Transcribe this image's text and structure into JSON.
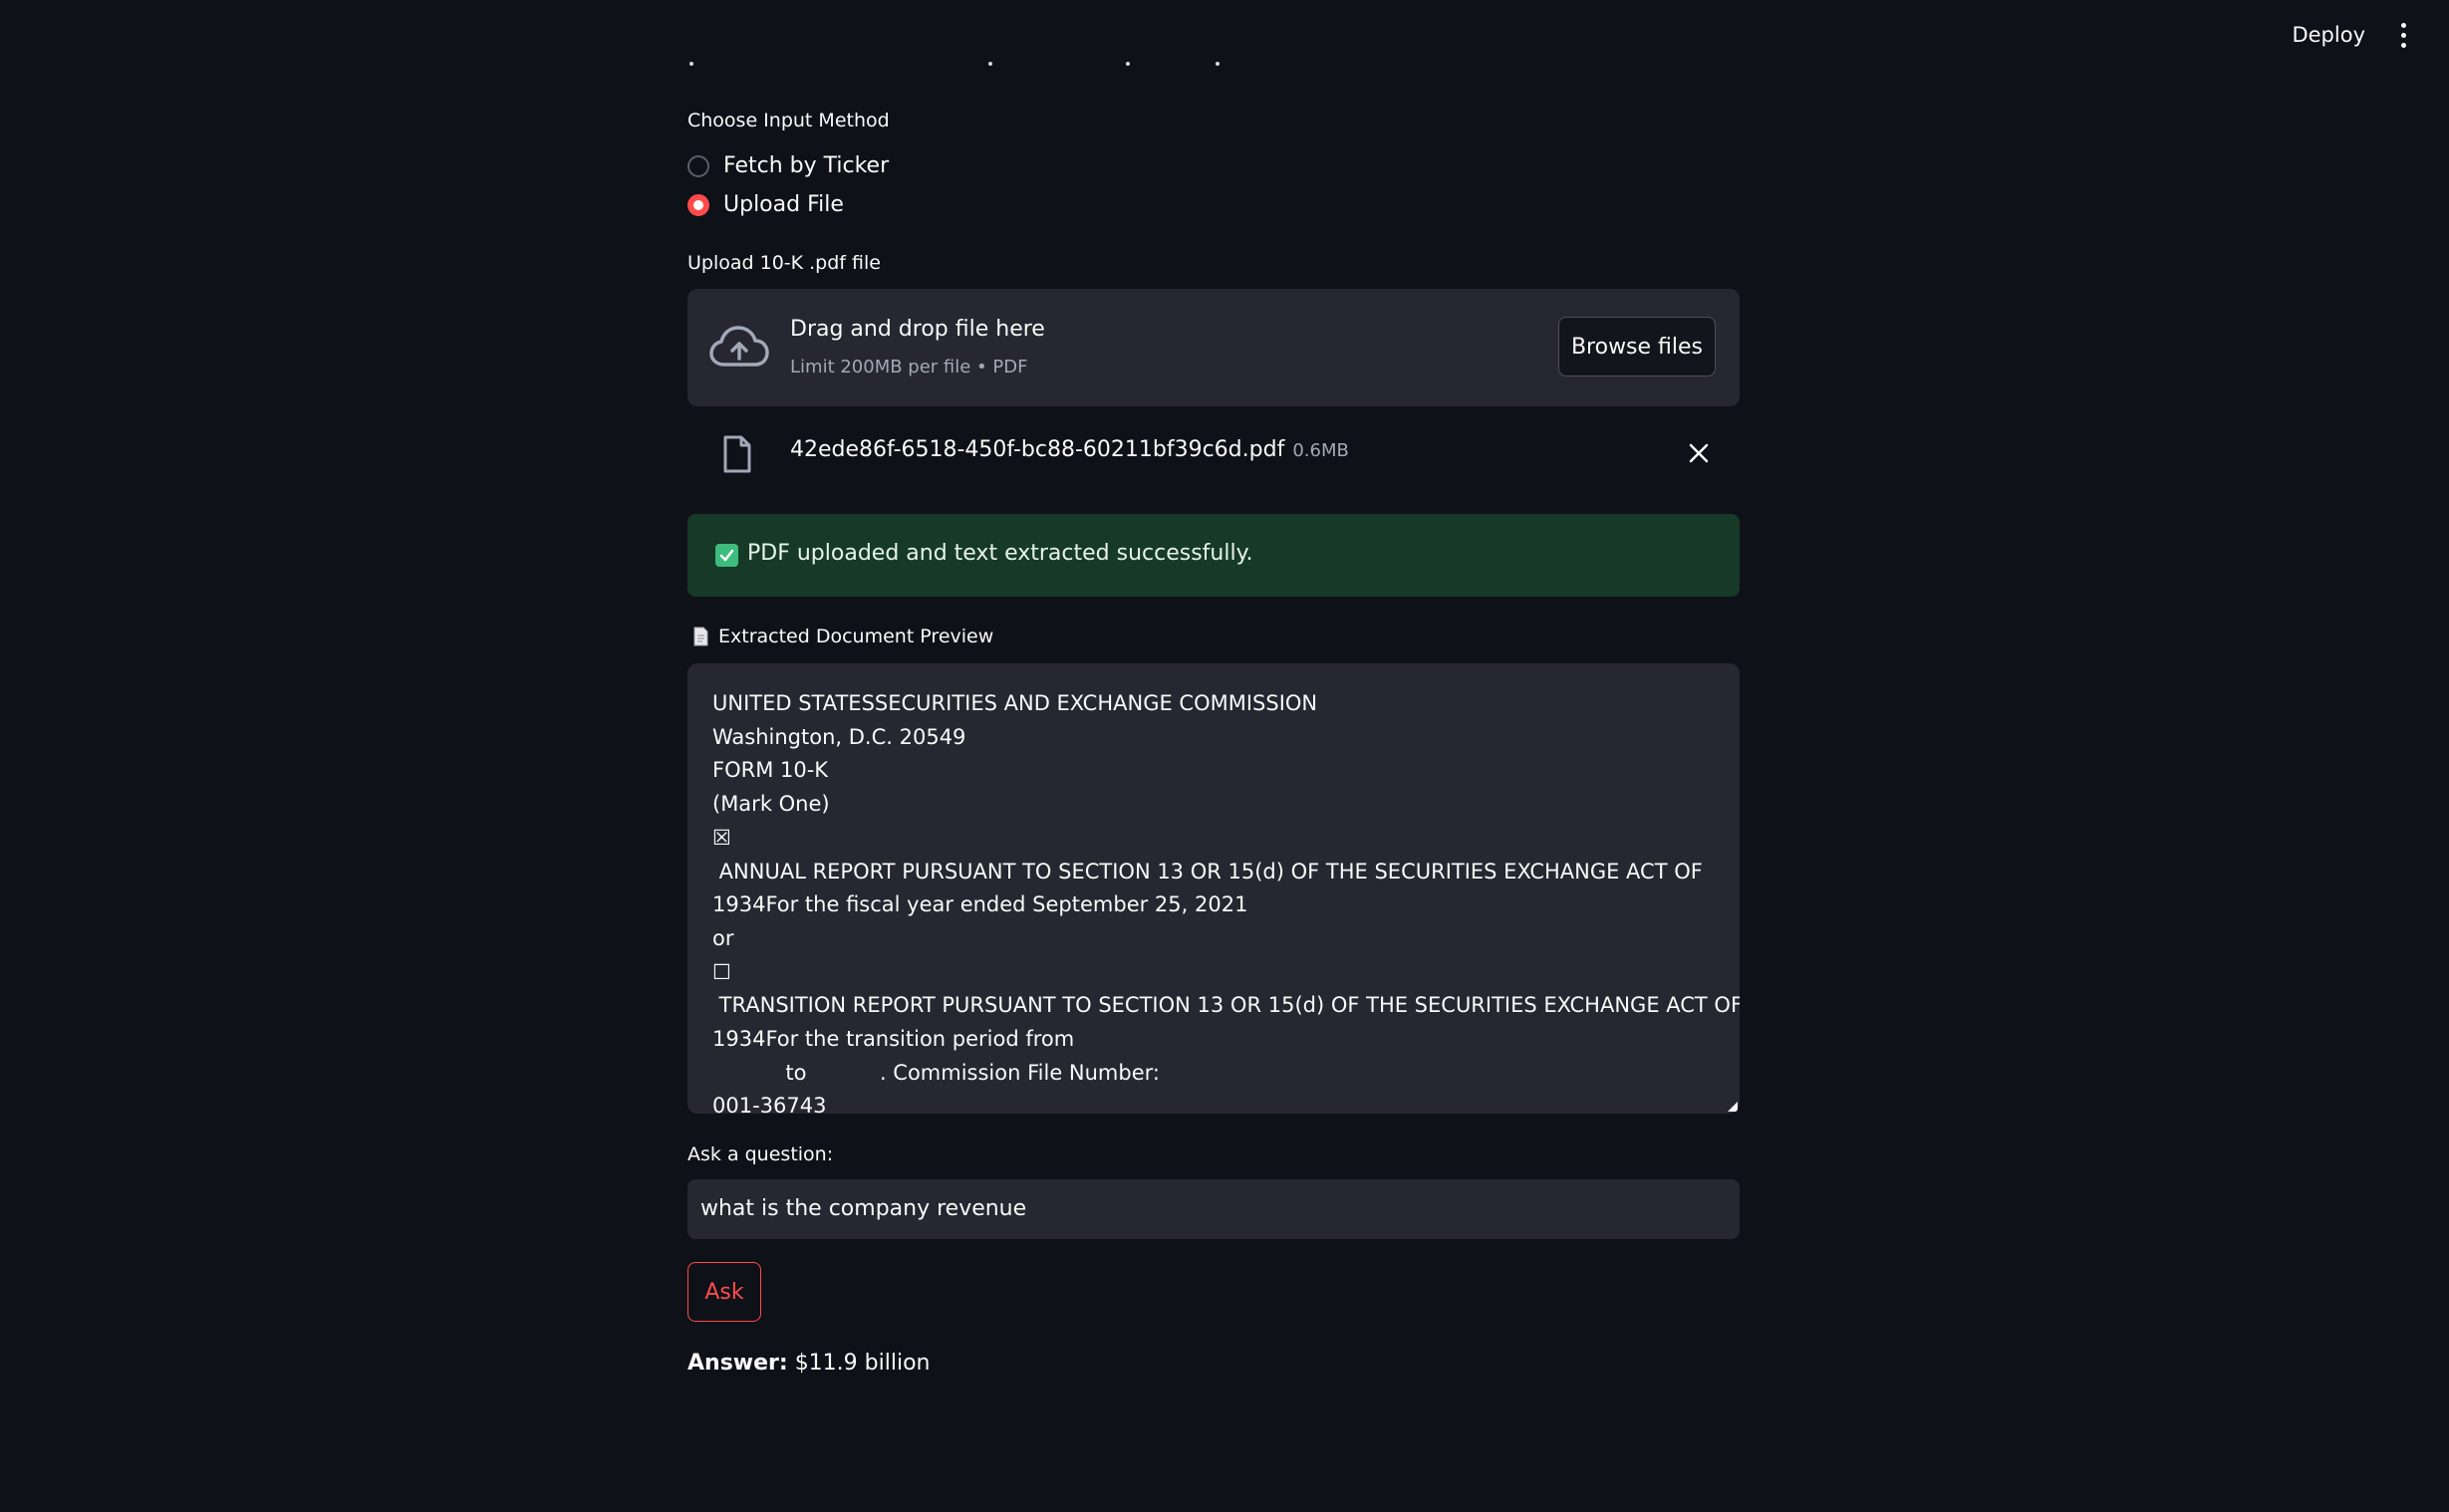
{
  "topbar": {
    "deploy_label": "Deploy",
    "menu_icon": "kebab-menu-icon"
  },
  "input_method": {
    "label": "Choose Input Method",
    "options": [
      {
        "label": "Fetch by Ticker",
        "selected": false
      },
      {
        "label": "Upload File",
        "selected": true
      }
    ]
  },
  "uploader": {
    "label": "Upload 10-K .pdf file",
    "drop_title": "Drag and drop file here",
    "drop_subtitle": "Limit 200MB per file • PDF",
    "browse_label": "Browse files",
    "icon": "cloud-upload-icon"
  },
  "uploaded_file": {
    "name": "42ede86f-6518-450f-bc88-60211bf39c6d.pdf",
    "size": "0.6MB",
    "icon": "file-icon"
  },
  "success_message": {
    "text": "PDF uploaded and text extracted successfully.",
    "icon": "checkmark-icon",
    "color": "#173928"
  },
  "preview": {
    "label": "Extracted Document Preview",
    "icon": "page-icon",
    "content": "UNITED STATESSECURITIES AND EXCHANGE COMMISSION\nWashington, D.C. 20549\nFORM 10-K\n(Mark One)\n☒\n ANNUAL REPORT PURSUANT TO SECTION 13 OR 15(d) OF THE SECURITIES EXCHANGE ACT OF\n1934For the fiscal year ended September 25, 2021\nor\n☐\n TRANSITION REPORT PURSUANT TO SECTION 13 OR 15(d) OF THE SECURITIES EXCHANGE ACT OF\n1934For the transition period from\n           to           . Commission File Number:\n001-36743"
  },
  "question": {
    "label": "Ask a question:",
    "value": "what is the company revenue"
  },
  "ask_button": {
    "label": "Ask",
    "color": "#ff4b4b"
  },
  "answer": {
    "label": "Answer:",
    "value": "$11.9 billion"
  }
}
